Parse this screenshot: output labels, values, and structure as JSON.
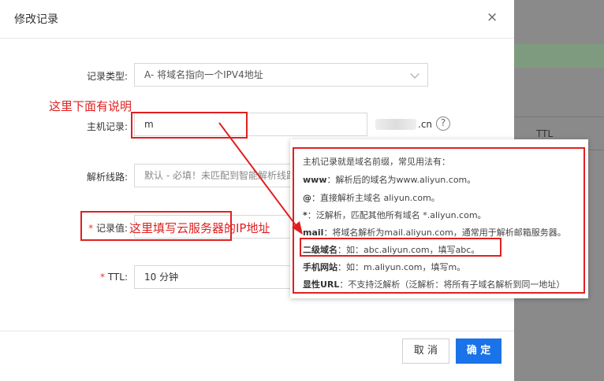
{
  "background": {
    "ttl_header": "TTL"
  },
  "modal": {
    "title": "修改记录",
    "close_glyph": "×",
    "record_type": {
      "label": "记录类型:",
      "value": "A- 将域名指向一个IPV4地址"
    },
    "host": {
      "label": "主机记录:",
      "value": "m",
      "domain_suffix": ".cn"
    },
    "route": {
      "label": "解析线路:",
      "value": "默认 - 必填！未匹配到智能解析线路"
    },
    "record_value": {
      "required_mark": "*",
      "label": "记录值:"
    },
    "ttl": {
      "required_mark": "*",
      "label": "TTL:",
      "value": "10 分钟"
    },
    "buttons": {
      "cancel": "取 消",
      "ok": "确 定"
    }
  },
  "tooltip": {
    "lines": [
      {
        "bold": "",
        "text": "主机记录就是域名前缀，常见用法有："
      },
      {
        "bold": "www",
        "text": "：解析后的域名为www.aliyun.com。"
      },
      {
        "bold": "@",
        "text": "：直接解析主域名 aliyun.com。"
      },
      {
        "bold": "*",
        "text": "：泛解析，匹配其他所有域名 *.aliyun.com。"
      },
      {
        "bold": "mail",
        "text": "：将域名解析为mail.aliyun.com，通常用于解析邮箱服务器。"
      },
      {
        "bold": "二级域名",
        "text": "：如：abc.aliyun.com，填写abc。"
      },
      {
        "bold": "手机网站",
        "text": "：如：m.aliyun.com，填写m。"
      },
      {
        "bold": "显性URL",
        "text": "：不支持泛解析（泛解析：将所有子域名解析到同一地址）"
      }
    ]
  },
  "annotations": {
    "host_note": "这里下面有说明",
    "value_note": "这里填写云服务器的IP地址",
    "color": "#e02020"
  },
  "icons": {
    "help": "?",
    "help_icon_name": "question-circle-icon"
  }
}
